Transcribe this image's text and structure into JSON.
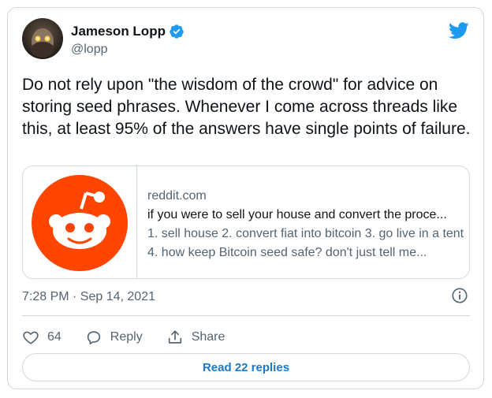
{
  "author": {
    "name": "Jameson Lopp",
    "handle": "@lopp",
    "verified": true
  },
  "tweet": {
    "text": "Do not rely upon \"the wisdom of the crowd\" for advice on storing seed phrases. Whenever I come across threads like this, at least 95% of the answers have single points of failure.",
    "timestamp": "7:28 PM · Sep 14, 2021"
  },
  "link_card": {
    "domain": "reddit.com",
    "title": "if you were to sell your house and convert the proce...",
    "description": "1. sell house 2. convert fiat into bitcoin 3. go live in a tent 4. how keep Bitcoin seed safe? don't just tell me..."
  },
  "actions": {
    "like_count": "64",
    "reply_label": "Reply",
    "share_label": "Share"
  },
  "read_replies_label": "Read 22 replies",
  "colors": {
    "twitter_blue": "#1d9bf0",
    "reddit_orange": "#ff4500",
    "muted_text": "#536471",
    "border": "#cfd9de"
  },
  "icons": [
    "avatar",
    "verified-badge-icon",
    "twitter-bird-icon",
    "reddit-logo-icon",
    "info-icon",
    "heart-icon",
    "reply-bubble-icon",
    "share-icon"
  ]
}
